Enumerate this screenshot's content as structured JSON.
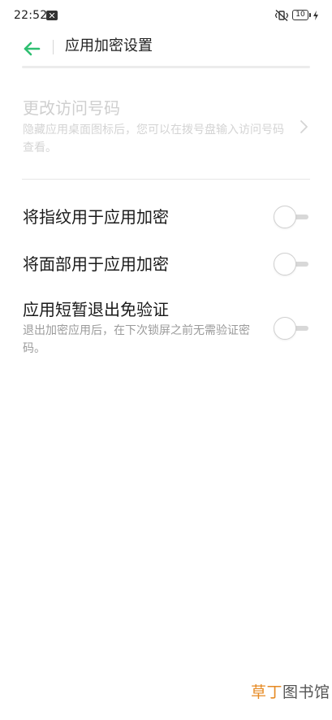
{
  "status_bar": {
    "time": "22:52",
    "notification_icon": "close-box-icon",
    "vibrate_icon": "vibrate-off-icon",
    "battery_level": "10",
    "charging_icon": "lightning-icon"
  },
  "header": {
    "back_icon": "arrow-left-icon",
    "title": "应用加密设置",
    "accent_color": "#2fbf71"
  },
  "access_code": {
    "title": "更改访问号码",
    "description": "隐藏应用桌面图标后，您可以在拨号盘输入访问号码查看。",
    "enabled": false,
    "chevron_icon": "chevron-right-icon"
  },
  "toggles": [
    {
      "label": "将指纹用于应用加密",
      "description": "",
      "on": false
    },
    {
      "label": "将面部用于应用加密",
      "description": "",
      "on": false
    },
    {
      "label": "应用短暂退出免验证",
      "description": "退出加密应用后，在下次锁屏之前无需验证密码。",
      "on": false
    }
  ],
  "watermark": {
    "accent_text": "草丁",
    "rest_text": "图书馆",
    "accent_color": "#e68a23"
  }
}
